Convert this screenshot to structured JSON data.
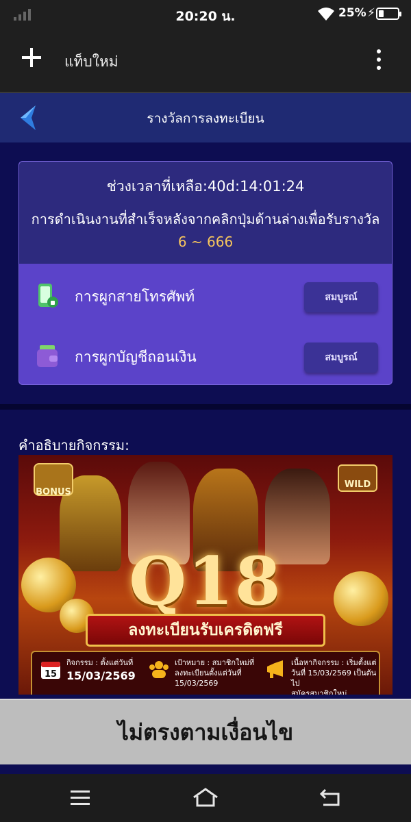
{
  "status_bar": {
    "time": "20:20 น.",
    "battery": "25%"
  },
  "browser": {
    "tab_title": "แท็บใหม่"
  },
  "header": {
    "title": "รางวัลการลงทะเบียน"
  },
  "card": {
    "countdown": "ช่วงเวลาที่เหลือ:40d:14:01:24",
    "instruction": "การดำเนินงานที่สำเร็จหลังจากคลิกปุ่มด้านล่างเพื่อรับรางวัล",
    "reward_range": "6 ~ 666",
    "tasks": [
      {
        "label": "การผูกสายโทรศัพท์",
        "button": "สมบูรณ์",
        "icon": "phone-bind-icon"
      },
      {
        "label": "การผูกบัญชีถอนเงิน",
        "button": "สมบูรณ์",
        "icon": "wallet-icon"
      }
    ]
  },
  "description": {
    "title": "คำอธิบายกิจกรรม:",
    "banner": {
      "brand": "Q18",
      "ribbon": "ลงทะเบียนรับเครดิตฟรี",
      "badge_left": "BONUS",
      "badge_right": "WILD",
      "info": [
        {
          "line1": "กิจกรรม : ตั้งแต่วันที่",
          "line2": "15/03/2569",
          "icon_text": "15"
        },
        {
          "line1": "เป้าหมาย : สมาชิกใหม่ที่",
          "line2": "ลงทะเบียนตั้งแต่วันที่",
          "line3": "15/03/2569"
        },
        {
          "line1": "เนื้อหากิจกรรม : เริ่มตั้งแต่",
          "line2": "วันที่ 15/03/2569 เป็นต้นไป",
          "line3": "สมัครสมาชิกใหม่"
        }
      ]
    }
  },
  "action_button": {
    "label": "ไม่ตรงตามเงื่อนไข"
  },
  "colors": {
    "page_bg": "#0d0d52",
    "card": "#5b43c9",
    "accent": "#f6c55d",
    "header": "#1f2a73"
  }
}
